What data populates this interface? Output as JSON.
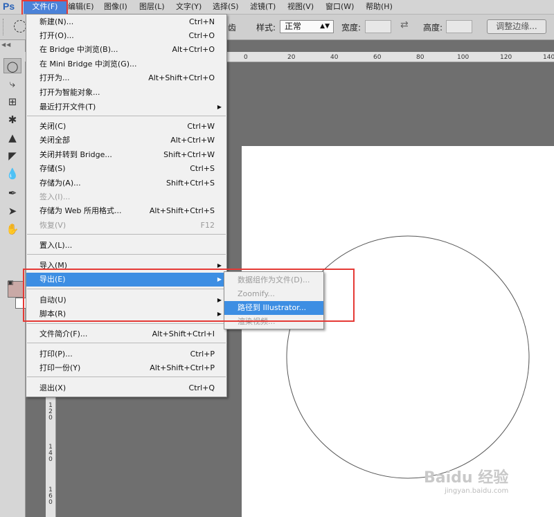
{
  "app": {
    "logo": "Ps"
  },
  "menubar": [
    {
      "label": "文件(F)",
      "active": true
    },
    {
      "label": "编辑(E)"
    },
    {
      "label": "图像(I)"
    },
    {
      "label": "图层(L)"
    },
    {
      "label": "文字(Y)"
    },
    {
      "label": "选择(S)"
    },
    {
      "label": "滤镜(T)"
    },
    {
      "label": "视图(V)"
    },
    {
      "label": "窗口(W)"
    },
    {
      "label": "帮助(H)"
    }
  ],
  "options_bar": {
    "partial_label": "齿",
    "style_label": "样式:",
    "style_value": "正常",
    "width_label": "宽度:",
    "height_label": "高度:",
    "refine_button": "调整边缘..."
  },
  "ruler_top_ticks": [
    "0",
    "20",
    "40",
    "60",
    "80",
    "100",
    "120",
    "140"
  ],
  "ruler_left_ticks": [
    "1\n2\n0",
    "1\n4\n0",
    "1\n6\n0"
  ],
  "file_menu": {
    "items": [
      {
        "label": "新建(N)...",
        "shortcut": "Ctrl+N"
      },
      {
        "label": "打开(O)...",
        "shortcut": "Ctrl+O"
      },
      {
        "label": "在 Bridge 中浏览(B)...",
        "shortcut": "Alt+Ctrl+O"
      },
      {
        "label": "在 Mini Bridge 中浏览(G)...",
        "shortcut": ""
      },
      {
        "label": "打开为...",
        "shortcut": "Alt+Shift+Ctrl+O"
      },
      {
        "label": "打开为智能对象...",
        "shortcut": ""
      },
      {
        "label": "最近打开文件(T)",
        "shortcut": "",
        "submenu": true
      },
      {
        "label": "关闭(C)",
        "shortcut": "Ctrl+W"
      },
      {
        "label": "关闭全部",
        "shortcut": "Alt+Ctrl+W"
      },
      {
        "label": "关闭并转到 Bridge...",
        "shortcut": "Shift+Ctrl+W"
      },
      {
        "label": "存储(S)",
        "shortcut": "Ctrl+S"
      },
      {
        "label": "存储为(A)...",
        "shortcut": "Shift+Ctrl+S"
      },
      {
        "label": "签入(I)...",
        "shortcut": "",
        "disabled": true
      },
      {
        "label": "存储为 Web 所用格式...",
        "shortcut": "Alt+Shift+Ctrl+S"
      },
      {
        "label": "恢复(V)",
        "shortcut": "F12",
        "disabled": true
      },
      {
        "label": "置入(L)...",
        "shortcut": ""
      },
      {
        "label": "导入(M)",
        "shortcut": "",
        "submenu": true
      },
      {
        "label": "导出(E)",
        "shortcut": "",
        "submenu": true,
        "hover": true
      },
      {
        "label": "自动(U)",
        "shortcut": "",
        "submenu": true
      },
      {
        "label": "脚本(R)",
        "shortcut": "",
        "submenu": true
      },
      {
        "label": "文件简介(F)...",
        "shortcut": "Alt+Shift+Ctrl+I"
      },
      {
        "label": "打印(P)...",
        "shortcut": "Ctrl+P"
      },
      {
        "label": "打印一份(Y)",
        "shortcut": "Alt+Shift+Ctrl+P"
      },
      {
        "label": "退出(X)",
        "shortcut": "Ctrl+Q"
      }
    ]
  },
  "export_submenu": {
    "items": [
      {
        "label": "数据组作为文件(D)...",
        "disabled": true
      },
      {
        "label": "Zoomify...",
        "disabled": true
      },
      {
        "label": "路径到 Illustrator...",
        "hover": true
      },
      {
        "label": "渲染视频...",
        "disabled": true
      }
    ]
  },
  "watermark": {
    "brand": "Baidu 经验",
    "url": "jingyan.baidu.com"
  },
  "colors": {
    "highlight_red": "#e53935",
    "menu_hover": "#3d8ee3",
    "foreground_swatch": "#c9a9a6",
    "background_swatch": "#ffffff"
  }
}
